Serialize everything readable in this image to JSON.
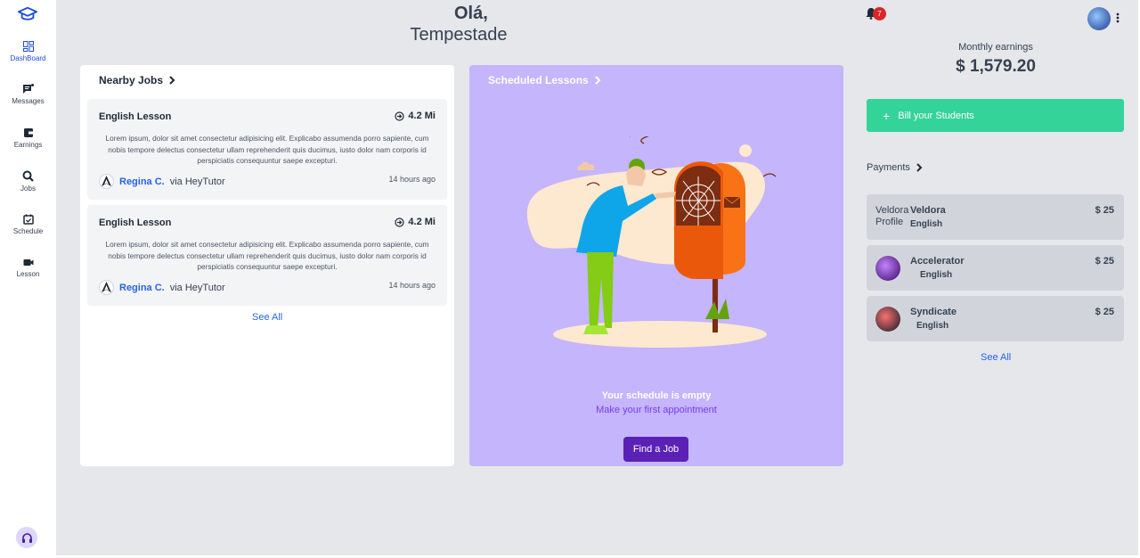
{
  "sidebar": {
    "items": [
      {
        "label": "DashBoard",
        "icon": "dashboard-icon"
      },
      {
        "label": "Messages",
        "icon": "messages-icon"
      },
      {
        "label": "Earnings",
        "icon": "wallet-icon"
      },
      {
        "label": "Jobs",
        "icon": "search-icon"
      },
      {
        "label": "Schedule",
        "icon": "calendar-icon"
      },
      {
        "label": "Lesson",
        "icon": "video-icon"
      }
    ]
  },
  "greeting": {
    "hello": "Olá,",
    "name": "Tempestade"
  },
  "nearby": {
    "title": "Nearby Jobs",
    "jobs": [
      {
        "title": "English Lesson",
        "distance": "4.2 Mi",
        "description": "Lorem ipsum, dolor sit amet consectetur adipisicing elit. Explicabo assumenda porro sapiente, cum nobis tempore delectus consectetur ullam reprehenderit quis ducimus, iusto dolor nam corporis id perspiciatis consequuntur saepe excepturi.",
        "author": "Regina C.",
        "via": "via HeyTutor",
        "time": "14 hours ago"
      },
      {
        "title": "English Lesson",
        "distance": "4.2 Mi",
        "description": "Lorem ipsum, dolor sit amet consectetur adipisicing elit. Explicabo assumenda porro sapiente, cum nobis tempore delectus consectetur ullam reprehenderit quis ducimus, iusto dolor nam corporis id perspiciatis consequuntur saepe excepturi.",
        "author": "Regina C.",
        "via": "via HeyTutor",
        "time": "14 hours ago"
      }
    ],
    "see_all": "See All"
  },
  "scheduled": {
    "title": "Scheduled Lessons",
    "empty_title": "Your schedule is empty",
    "empty_sub": "Make your first appointment",
    "button": "Find a Job"
  },
  "header": {
    "notifications": "7"
  },
  "earnings": {
    "label": "Monthly earnings",
    "value": "$ 1,579.20"
  },
  "bill": {
    "label": "Bill your Students"
  },
  "payments": {
    "title": "Payments",
    "items": [
      {
        "name": "Veldora",
        "sub": "English",
        "amount": "$ 25",
        "img_alt": "Veldora Profile"
      },
      {
        "name": "Accelerator",
        "sub": "English",
        "amount": "$ 25"
      },
      {
        "name": "Syndicate",
        "sub": "English",
        "amount": "$ 25"
      }
    ],
    "see_all": "See All"
  },
  "colors": {
    "accent": "#2563eb",
    "schedule_bg": "#c4b5fd",
    "bill_green": "#34d399",
    "find_job": "#5b21b6",
    "badge": "#dc2626"
  }
}
